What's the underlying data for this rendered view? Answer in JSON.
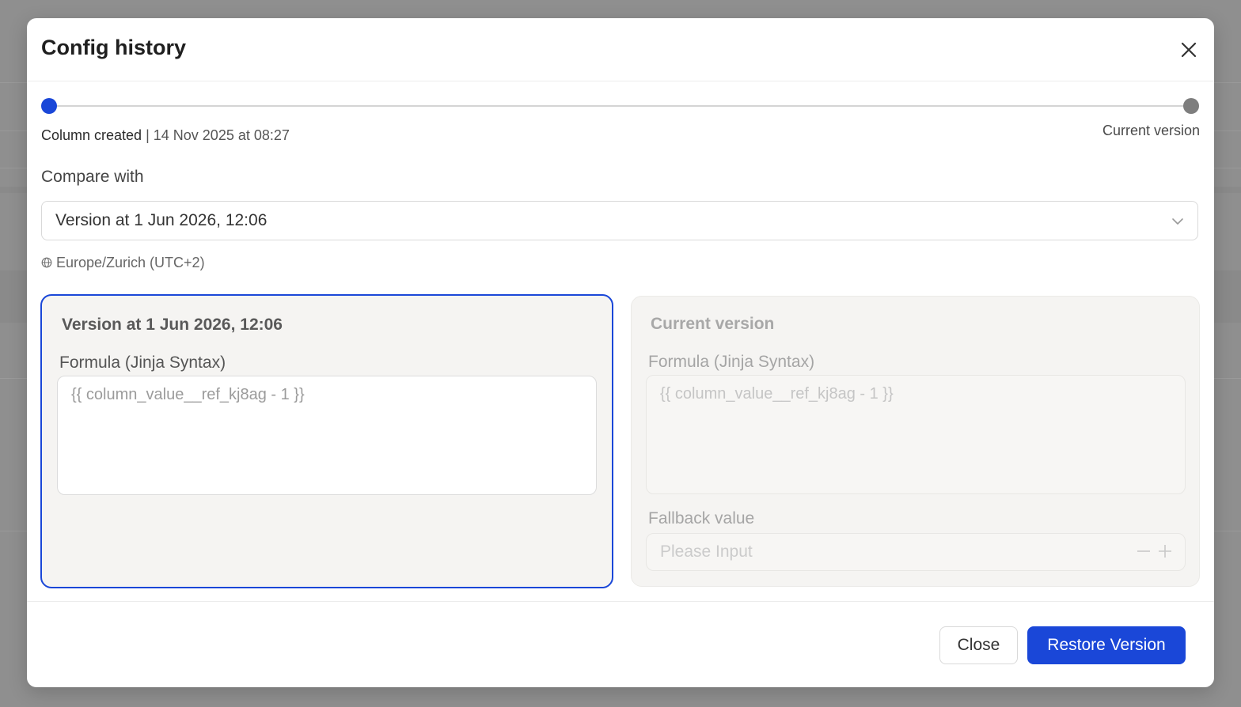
{
  "modal": {
    "title": "Config history",
    "close_icon": "close-icon"
  },
  "timeline": {
    "start_event": "Column created",
    "start_separator": " | ",
    "start_date": "14 Nov 2025 at 08:27",
    "end_label": "Current version",
    "colors": {
      "active": "#1a47d8",
      "inactive": "#7e7e7e"
    }
  },
  "compare": {
    "label": "Compare with",
    "selected": "Version at 1 Jun 2026, 12:06",
    "chevron_icon": "chevron-down-icon"
  },
  "timezone": {
    "icon": "globe-icon",
    "text": "Europe/Zurich (UTC+2)"
  },
  "selected_version": {
    "title": "Version at 1 Jun 2026, 12:06",
    "formula_label": "Formula (Jinja Syntax)",
    "formula_value": "{{ column_value__ref_kj8ag - 1 }}"
  },
  "current_version": {
    "title": "Current version",
    "formula_label": "Formula (Jinja Syntax)",
    "formula_value": "{{ column_value__ref_kj8ag - 1 }}",
    "fallback_label": "Fallback value",
    "fallback_placeholder": "Please Input",
    "stepper_icons": [
      "minus-icon",
      "plus-icon"
    ]
  },
  "footer": {
    "close_label": "Close",
    "restore_label": "Restore Version",
    "accent": "#1a47d8"
  }
}
